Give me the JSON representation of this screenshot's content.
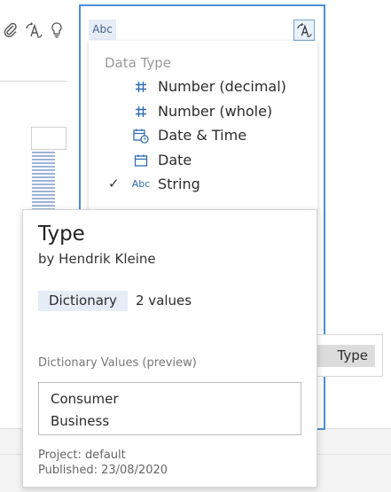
{
  "toolbar": {
    "icons": [
      "paperclip-icon",
      "change-type-icon",
      "lightbulb-icon"
    ]
  },
  "column_card": {
    "type_chip_label": "Abc"
  },
  "data_type_menu": {
    "heading": "Data Type",
    "items": [
      {
        "icon": "#",
        "label": "Number (decimal)",
        "selected": false
      },
      {
        "icon": "#",
        "label": "Number (whole)",
        "selected": false
      },
      {
        "icon": "calendar-clock",
        "label": "Date & Time",
        "selected": false
      },
      {
        "icon": "calendar",
        "label": "Date",
        "selected": false
      },
      {
        "icon": "Abc",
        "label": "String",
        "selected": true
      }
    ]
  },
  "background_chip": {
    "label": "Type"
  },
  "tooltip": {
    "title": "Type",
    "author": "by Hendrik Kleine",
    "badge": "Dictionary",
    "value_count": "2 values",
    "preview_label": "Dictionary Values (preview)",
    "values": [
      "Consumer",
      "Business"
    ],
    "project": "Project: default",
    "published": "Published: 23/08/2020"
  },
  "colors": {
    "accent": "#4a8fd4",
    "icon_blue": "#2f6db2",
    "badge_bg": "#e6edf6"
  }
}
